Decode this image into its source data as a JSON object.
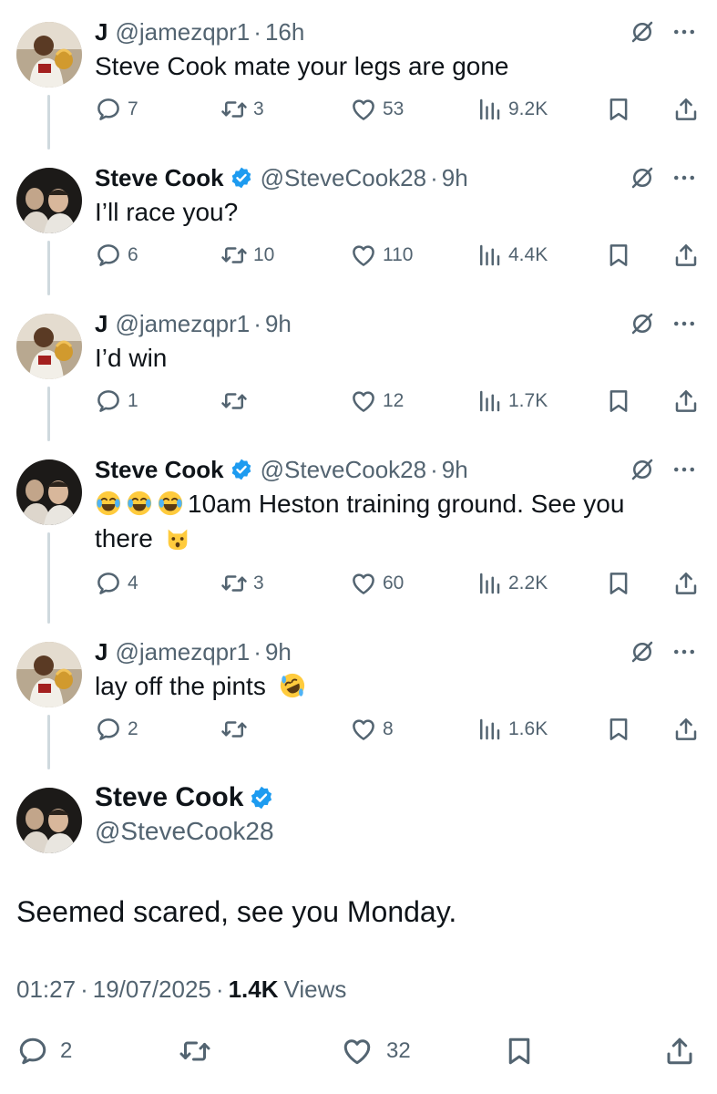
{
  "tweets": [
    {
      "name": "J",
      "verified": false,
      "handle": "@jamezqpr1",
      "time": "16h",
      "text": "Steve Cook mate your legs are gone",
      "replies": "7",
      "reposts": "3",
      "likes": "53",
      "views": "9.2K"
    },
    {
      "name": "Steve Cook",
      "verified": true,
      "handle": "@SteveCook28",
      "time": "9h",
      "text": "I’ll race you?",
      "replies": "6",
      "reposts": "10",
      "likes": "110",
      "views": "4.4K"
    },
    {
      "name": "J",
      "verified": false,
      "handle": "@jamezqpr1",
      "time": "9h",
      "text": "I’d win",
      "replies": "1",
      "reposts": "",
      "likes": "12",
      "views": "1.7K"
    },
    {
      "name": "Steve Cook",
      "verified": true,
      "handle": "@SteveCook28",
      "time": "9h",
      "text_line1": "10am Heston training ground. See you",
      "text_line2": "there",
      "emojis": [
        "joy-emoji",
        "joy-emoji",
        "joy-emoji",
        "cat-emoji"
      ],
      "replies": "4",
      "reposts": "3",
      "likes": "60",
      "views": "2.2K"
    },
    {
      "name": "J",
      "verified": false,
      "handle": "@jamezqpr1",
      "time": "9h",
      "text": "lay off the pints",
      "emojis": [
        "rofl-emoji"
      ],
      "replies": "2",
      "reposts": "",
      "likes": "8",
      "views": "1.6K"
    }
  ],
  "main": {
    "name": "Steve Cook",
    "handle": "@SteveCook28",
    "text": "Seemed scared, see you Monday.",
    "time": "01:27",
    "date": "19/07/2025",
    "views_count": "1.4K",
    "views_label": "Views",
    "replies": "2",
    "likes": "32"
  },
  "separator": "·",
  "colors": {
    "text": "#0f1419",
    "secondary": "#536471",
    "verified": "#1d9bf0",
    "thread_line": "#cfd9de"
  }
}
